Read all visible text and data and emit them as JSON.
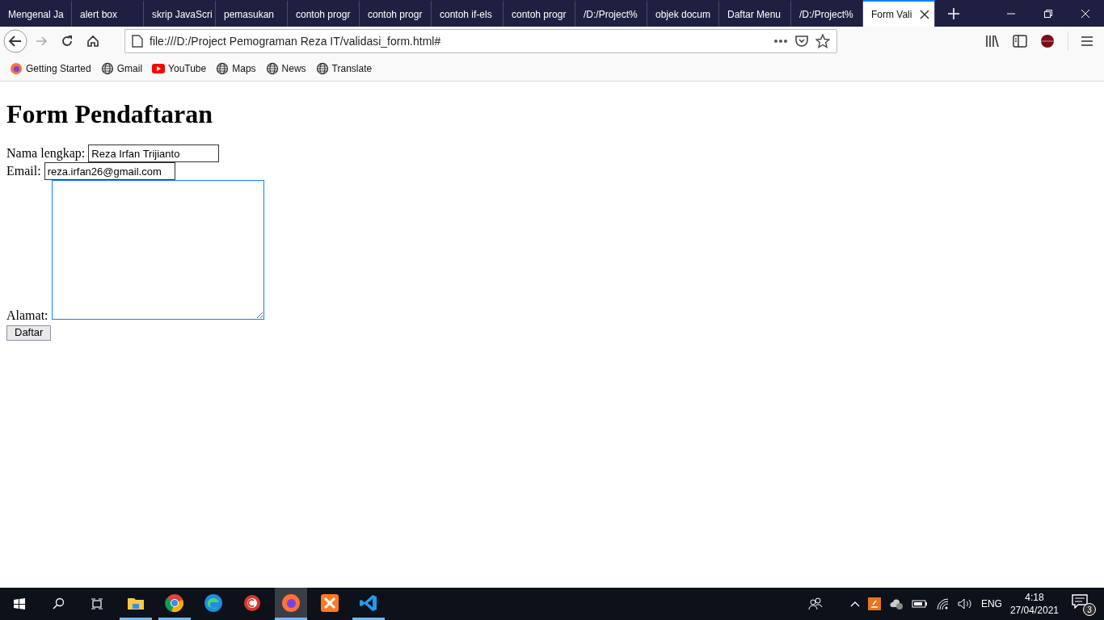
{
  "tabs": [
    {
      "label": "Mengenal Ja",
      "selected": false
    },
    {
      "label": "alert box",
      "selected": false
    },
    {
      "label": "skrip JavaScri",
      "selected": false
    },
    {
      "label": "pemasukan",
      "selected": false
    },
    {
      "label": "contoh progr",
      "selected": false
    },
    {
      "label": "contoh progr",
      "selected": false
    },
    {
      "label": "contoh if-els",
      "selected": false
    },
    {
      "label": "contoh progr",
      "selected": false
    },
    {
      "label": "/D:/Project%",
      "selected": false
    },
    {
      "label": "objek docum",
      "selected": false
    },
    {
      "label": "Daftar Menu",
      "selected": false
    },
    {
      "label": "/D:/Project%",
      "selected": false
    },
    {
      "label": "Form Vali",
      "selected": true
    }
  ],
  "address_bar": {
    "url": "file:///D:/Project Pemograman Reza IT/validasi_form.html#"
  },
  "bookmarks": [
    {
      "label": "Getting Started",
      "kind": "firefox"
    },
    {
      "label": "Gmail",
      "kind": "globe"
    },
    {
      "label": "YouTube",
      "kind": "youtube"
    },
    {
      "label": "Maps",
      "kind": "globe"
    },
    {
      "label": "News",
      "kind": "globe"
    },
    {
      "label": "Translate",
      "kind": "globe"
    }
  ],
  "page": {
    "title": "Form Pendaftaran",
    "fields": [
      {
        "label": "Nama lengkap:",
        "kind": "text",
        "value": "Reza Irfan Trijianto",
        "focused": false
      },
      {
        "label": "Email:",
        "kind": "text",
        "value": "reza.irfan26@gmail.com",
        "focused": false
      },
      {
        "label": "Alamat:",
        "kind": "textarea",
        "focused": true
      }
    ],
    "submit": "Daftar"
  },
  "taskbar": {
    "apps": [
      {
        "kind": "explorer",
        "running": true,
        "active": false
      },
      {
        "kind": "chrome",
        "running": true,
        "active": false
      },
      {
        "kind": "edge",
        "running": false,
        "active": false
      },
      {
        "kind": "ccleaner",
        "running": false,
        "active": false
      },
      {
        "kind": "firefox",
        "running": true,
        "active": true
      },
      {
        "kind": "xampp",
        "running": false,
        "active": false
      },
      {
        "kind": "vscode",
        "running": true,
        "active": false
      }
    ],
    "language": "ENG",
    "time": "4:18",
    "date": "27/04/2021",
    "notifications": "3"
  }
}
